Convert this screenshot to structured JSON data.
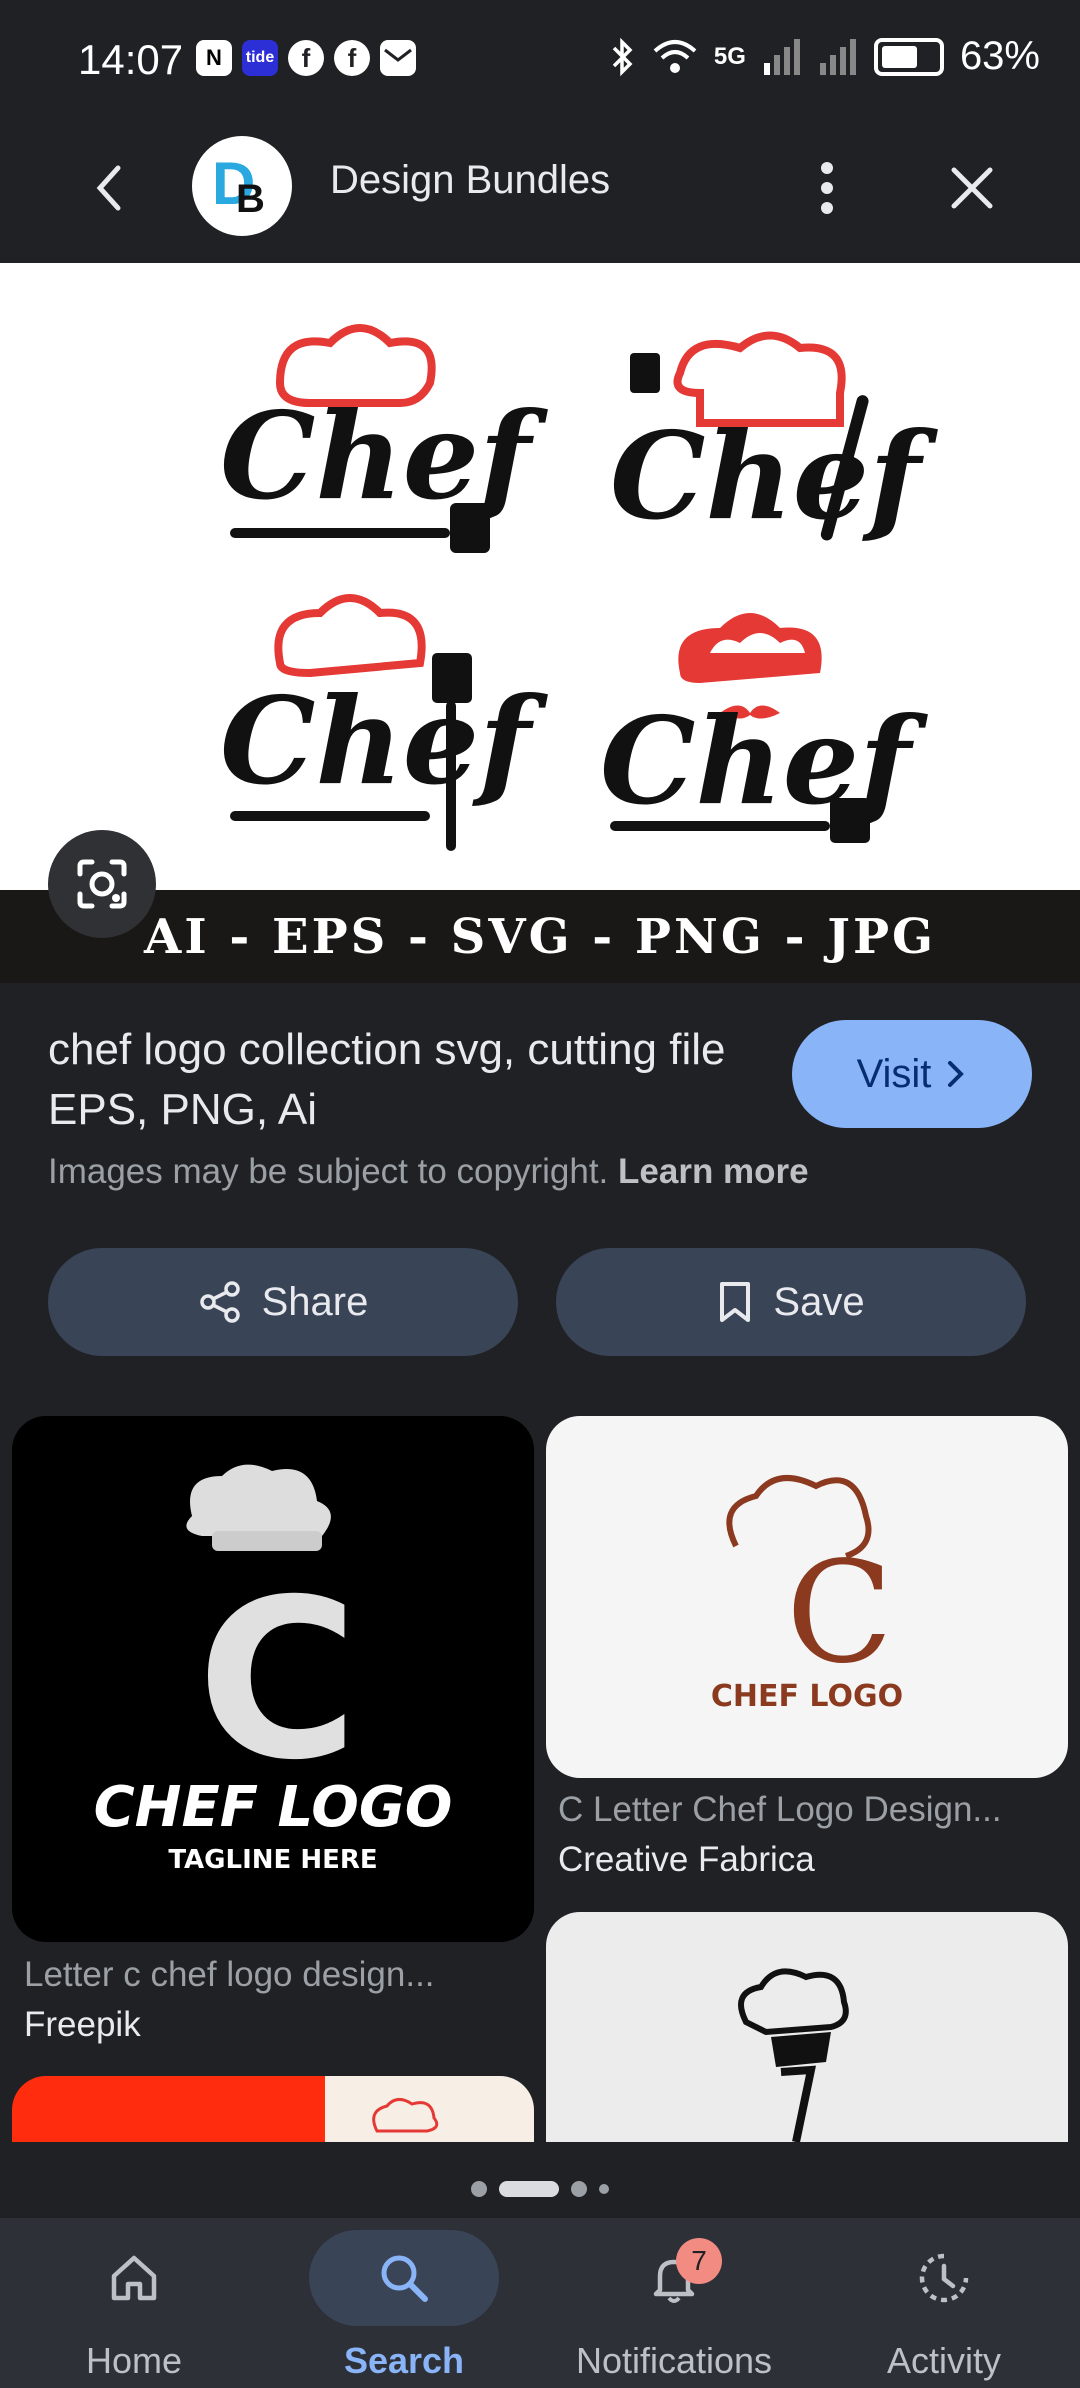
{
  "status_bar": {
    "time": "14:07",
    "left_icons": [
      "nfc-icon",
      "tide-icon",
      "facebook-icon",
      "facebook-icon",
      "mail-icon"
    ],
    "tide_label": "tide",
    "network": "5G",
    "battery": "63%",
    "battery_level": 0.63
  },
  "header": {
    "site_name": "Design Bundles",
    "avatar_text": "B"
  },
  "hero": {
    "logo_word": "Chef",
    "formats": "AI - EPS - SVG - PNG - JPG"
  },
  "result": {
    "title": "chef logo collection svg, cutting file EPS, PNG, Ai",
    "visit_label": "Visit",
    "copyright_text": "Images may be subject to copyright.",
    "learn_more": "Learn more",
    "share_label": "Share",
    "save_label": "Save"
  },
  "related": [
    {
      "title": "Letter c chef logo design...",
      "source": "Freepik",
      "art_main": "CHEF LOGO",
      "art_sub": "TAGLINE HERE",
      "art_letter": "C"
    },
    {
      "title": "C Letter Chef Logo Design...",
      "source": "Creative Fabrica",
      "art_main": "CHEF LOGO",
      "art_letter": "C"
    }
  ],
  "pager": {
    "pages": 4,
    "current": 2
  },
  "bottom_nav": [
    {
      "label": "Home",
      "icon": "home-icon"
    },
    {
      "label": "Search",
      "icon": "search-icon",
      "active": true
    },
    {
      "label": "Notifications",
      "icon": "bell-icon",
      "badge": "7"
    },
    {
      "label": "Activity",
      "icon": "activity-icon"
    }
  ],
  "colors": {
    "background": "#202124",
    "accent": "#8ab4f8",
    "pill": "#394457",
    "chef_red": "#e53935",
    "brown": "#8b3a1f"
  }
}
